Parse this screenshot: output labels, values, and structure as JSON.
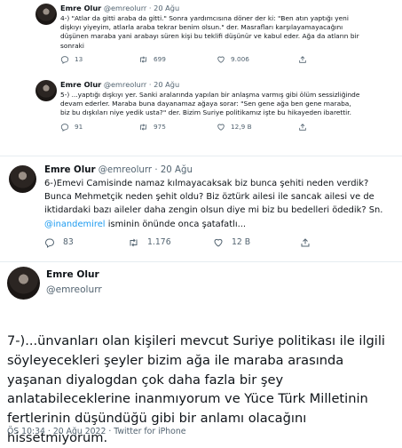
{
  "embed1": {
    "name": "Emre Olur",
    "handle": "@emreolurr",
    "date": "20 Ağu",
    "text": "4-) \"Atlar da gitti araba da gitti.\" Sonra yardımcısına döner der ki: \"Ben atın yaptığı yeni dişkıyı yiyeyim, atlarla araba tekrar benim olsun.\" der. Masrafları karşılayamayacağını düşünen maraba yani arabayı süren kişi bu teklifi düşünür ve kabul eder. Ağa da atların bir sonraki",
    "replies": "13",
    "retweets": "699",
    "likes": "9.006"
  },
  "embed2": {
    "name": "Emre Olur",
    "handle": "@emreolurr",
    "date": "20 Ağu",
    "text": "5-) ...yaptığı dışkıyı yer. Sanki aralarında yapılan bir anlaşma varmış gibi ölüm sessizliğinde devam ederler. Maraba buna dayanamaz ağaya sorar: \"Sen gene ağa ben gene maraba, biz bu dışkıları niye yedik usta?\" der. Bizim Suriye politikamız işte bu hikayeden ibarettir.",
    "replies": "91",
    "retweets": "975",
    "likes": "12,9 B"
  },
  "tweet3": {
    "name": "Emre Olur",
    "handle": "@emreolurr",
    "date": "20 Ağu",
    "text_before": "6-)Emevi Camisinde namaz kılmayacaksak biz bunca şehiti neden verdik? Bunca Mehmetçik neden şehit oldu? Biz öztürk ailesi ile sancak ailesi ve de iktidardaki bazı aileler daha zengin olsun diye mi biz bu bedelleri ödedik? Sn. ",
    "mention": "@inandemirel",
    "text_after": " isminin önünde onca şatafatlı...",
    "replies": "83",
    "retweets": "1.176",
    "likes": "12 B"
  },
  "tweet4": {
    "name": "Emre Olur",
    "handle": "@emreolurr",
    "text": "7-)...ünvanları olan kişileri mevcut Suriye politikası ile ilgili söyleyecekleri şeyler bizim ağa ile maraba arasında yaşanan diyalogdan çok daha fazla bir şey anlatabileceklerine inanmıyorum ve Yüce Türk Milletinin fertlerinin düşündüğü gibi bir anlamı olacağını hissetmiyorum.",
    "meta": "ÖS 10:34 · 20 Ağu 2022 · Twitter for iPhone"
  }
}
